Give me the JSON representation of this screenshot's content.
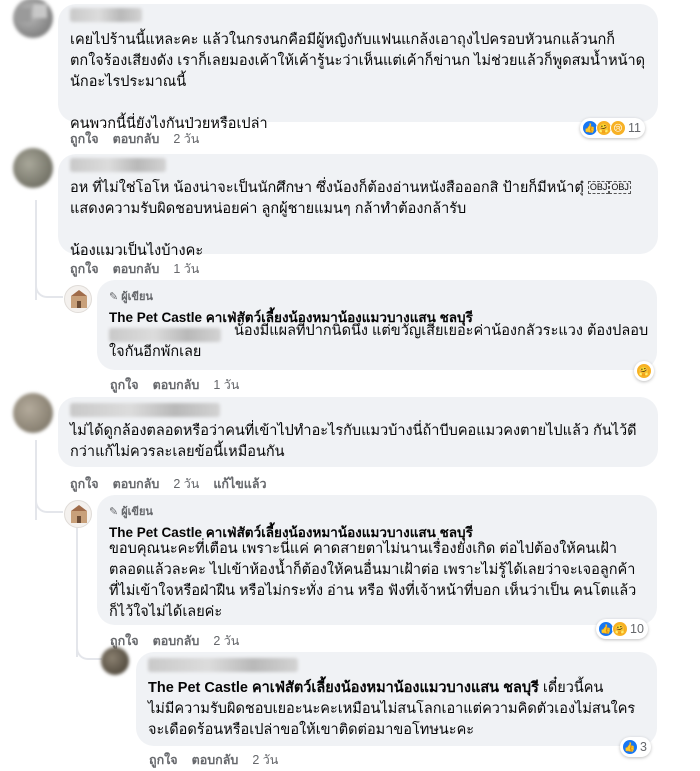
{
  "comments": [
    {
      "text": "เคยไปร้านนี้แหละคะ แล้วในกรงนกคือมีผู้หญิงกับแฟนแกล้งเอาถุงไปครอบหัวนกแล้วนกก็\nตกใจร้องเสียงดัง เราก็เลยมองเค้าให้เค้ารู้นะว่าเห็นแต่เค้าก็ข่านก ไม่ช่วยแล้วก็พูดสมน้ำหน้าดุ\nนักอะไรประมาณนี้\n\nคนพวกนี้นี่ยังไงกันป่วยหรือเปล่า",
      "like": "ถูกใจ",
      "reply": "ตอบกลับ",
      "time": "2 วัน",
      "react_count": "11"
    },
    {
      "text_part1": "อห ที่ไม่ใช่โอโห น้องน่าจะเป็นนักศึกษา ซึ่งน้องก็ต้องอ่านหนังสือออกสิ ป้ายก็มีหน้าตุ๋ ",
      "obj": "OBJ",
      "text_part2": "\nแสดงความรับผิดชอบหน่อยค่า ลูกผู้ชายแมนๆ กล้าทำต้องกล้ารับ\n\nน้องแมวเป็นไงบ้างคะ",
      "like": "ถูกใจ",
      "reply": "ตอบกลับ",
      "time": "1 วัน"
    },
    {
      "author_tag": "ผู้เขียน",
      "page_name": "The Pet Castle คาเฟ่สัตว์เลี้ยงน้องหมาน้องแมวบางแสน ชลบุรี",
      "text": "น้องมีแผลที่ปากนิดนึง แต่ขวัญเสียเยอะค่าน้องกลัวระแวง ต้องปลอบ\nใจกันอีกพักเลย",
      "like": "ถูกใจ",
      "reply": "ตอบกลับ",
      "time": "1 วัน"
    },
    {
      "text": "ไม่ได้ดูกล้องตลอดหรือว่าคนที่เข้าไปทำอะไรกับแมวบ้างนี่ถ้าบีบคอแมวคงตายไปแล้ว กันไว้ดี\nกว่าแก้ไม่ควรละเลยข้อนี้เหมือนกัน",
      "like": "ถูกใจ",
      "reply": "ตอบกลับ",
      "time": "2 วัน",
      "edited": "แก้ไขแล้ว"
    },
    {
      "author_tag": "ผู้เขียน",
      "page_name": "The Pet Castle คาเฟ่สัตว์เลี้ยงน้องหมาน้องแมวบางแสน ชลบุรี",
      "text": "ขอบคุณนะคะที่เตือน เพราะนี่แค่ คาดสายตาไม่นานเรื่องยังเกิด ต่อไปต้องให้คนเฝ้า\nตลอดแล้วละคะ ไปเข้าห้องน้ำก็ต้องให้คนอื่นมาเฝ้าต่อ เพราะไม่รู้ได้เลยว่าจะเจอลูกค้า\nที่ไม่เข้าใจหรือฝ่าฝืน หรือไม่กระทั่ง อ่าน หรือ ฟังที่เจ้าหน้าที่บอก เห็นว่าเป็น คนโตแล้ว\nก็ไว้ใจไม่ได้เลยค่ะ",
      "like": "ถูกใจ",
      "reply": "ตอบกลับ",
      "time": "2 วัน",
      "react_count": "10"
    },
    {
      "mention": "The Pet Castle คาเฟ่สัตว์เลี้ยงน้องหมาน้องแมวบางแสน ชลบุรี",
      "text_after": " เดี๋ยวนี้คน",
      "text": "ไม่มีความรับผิดชอบเยอะนะคะเหมือนไม่สนโลกเอาแต่ความคิดตัวเองไม่สนใคร\nจะเดือดร้อนหรือเปล่าขอให้เขาติดต่อมาขอโทษนะคะ",
      "like": "ถูกใจ",
      "reply": "ตอบกลับ",
      "time": "2 วัน",
      "react_count": "3"
    }
  ],
  "colors": {
    "bubble": "#f0f2f5",
    "meta": "#65676b",
    "like_blue": "#1877f2",
    "care_yellow": "#f7b125"
  },
  "icons": [
    "like-icon",
    "care-icon",
    "sad-icon",
    "pencil-icon"
  ]
}
